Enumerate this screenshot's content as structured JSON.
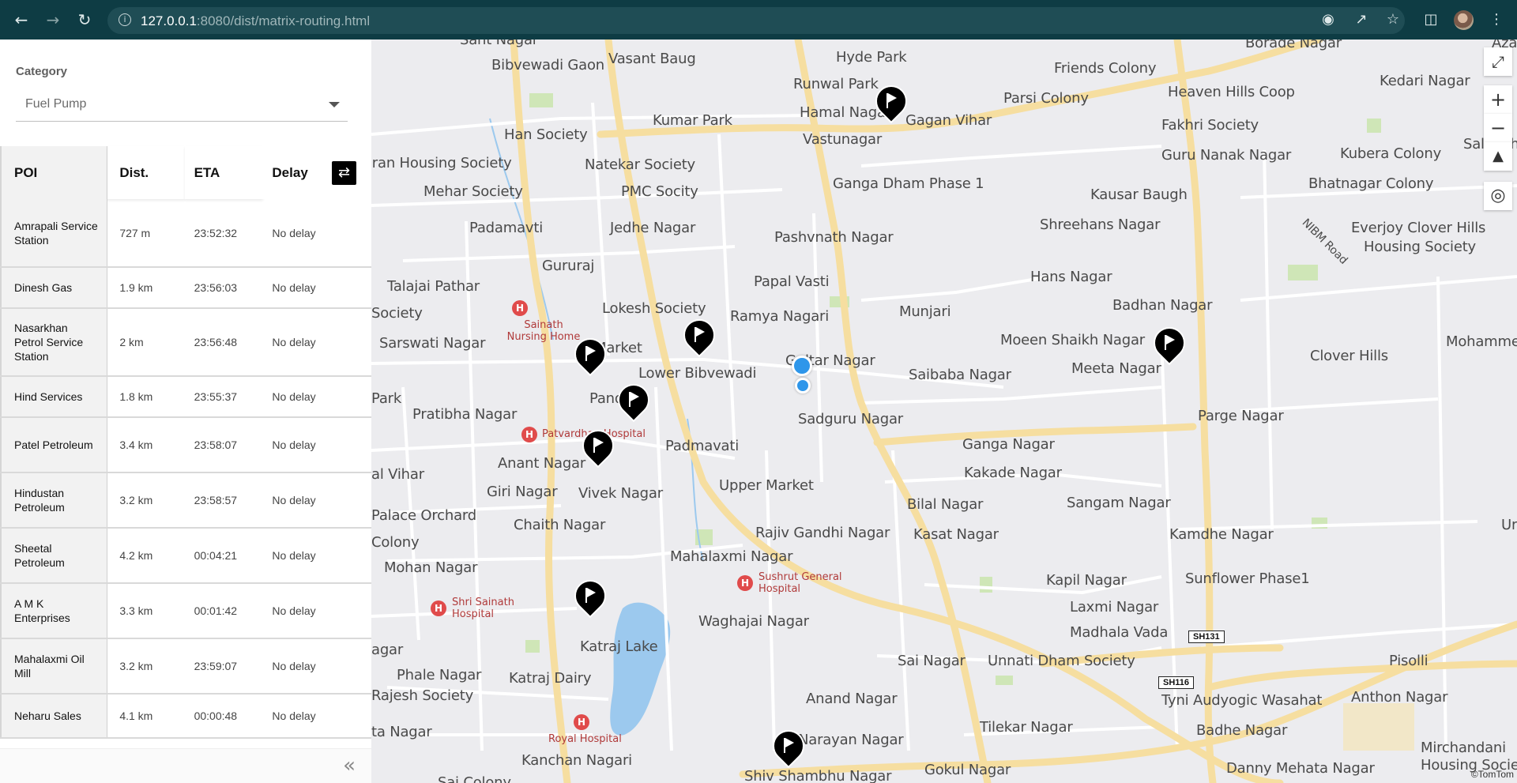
{
  "browser": {
    "url_host": "127.0.0.1",
    "url_rest": ":8080/dist/matrix-routing.html",
    "icons": [
      "back-icon",
      "forward-icon",
      "reload-icon",
      "info-icon",
      "location-icon",
      "share-icon",
      "star-icon",
      "sidepanel-icon",
      "profile-avatar",
      "menu-icon"
    ]
  },
  "sidebar": {
    "category_label": "Category",
    "category_value": "Fuel Pump",
    "columns": [
      "POI",
      "Dist.",
      "ETA",
      "Delay"
    ],
    "swap_icon": "swap-icon",
    "rows": [
      {
        "poi": "Amrapali Service Station",
        "dist": "727 m",
        "eta": "23:52:32",
        "delay": "No delay"
      },
      {
        "poi": "Dinesh Gas",
        "dist": "1.9 km",
        "eta": "23:56:03",
        "delay": "No delay"
      },
      {
        "poi": "Nasarkhan Petrol Service Station",
        "dist": "2 km",
        "eta": "23:56:48",
        "delay": "No delay"
      },
      {
        "poi": "Hind Services",
        "dist": "1.8 km",
        "eta": "23:55:37",
        "delay": "No delay"
      },
      {
        "poi": "Patel Petroleum",
        "dist": "3.4 km",
        "eta": "23:58:07",
        "delay": "No delay"
      },
      {
        "poi": "Hindustan Petroleum",
        "dist": "3.2 km",
        "eta": "23:58:57",
        "delay": "No delay"
      },
      {
        "poi": "Sheetal Petroleum",
        "dist": "4.2 km",
        "eta": "00:04:21",
        "delay": "No delay"
      },
      {
        "poi": "A M K Enterprises",
        "dist": "3.3 km",
        "eta": "00:01:42",
        "delay": "No delay"
      },
      {
        "poi": "Mahalaxmi Oil Mill",
        "dist": "3.2 km",
        "eta": "23:59:07",
        "delay": "No delay"
      },
      {
        "poi": "Neharu Sales",
        "dist": "4.1 km",
        "eta": "00:00:48",
        "delay": "No delay"
      }
    ],
    "collapse_icon": "double-chevron-left-icon"
  },
  "map": {
    "places": [
      "Sant Nagar",
      "Bibvewadi Gaon",
      "Vasant Baug",
      "Hyde Park",
      "Friends Colony",
      "Borade Nagar",
      "Azad Nag",
      "Kedari Nagar",
      "Runwal Park",
      "Hamal Nagar",
      "Gagan Vihar",
      "Parsi Colony",
      "Heaven Hills Coop",
      "Kumar Park",
      "Fakhri Society",
      "Han Society",
      "Vastunagar",
      "Guru Nanak Nagar",
      "Kubera Colony",
      "Salunkhe",
      "iran Housing Society",
      "Natekar Society",
      "Ganga Dham Phase 1",
      "Bhatnagar Colony",
      "Mehar Society",
      "PMC Socity",
      "Kausar Baugh",
      "Padamavti",
      "Jedhe Nagar",
      "Pashvnath Nagar",
      "Shreehans Nagar",
      "Everjoy Clover Hills",
      "Housing Society",
      "Gururaj",
      "Talajai Pathar",
      "Papal Vasti",
      "Hans Nagar",
      "Lokesh Society",
      "Ramya Nagari",
      "Munjari",
      "Badhan Nagar",
      "Society",
      "Sarswati Nagar",
      "Market",
      "Moeen Shaikh Nagar",
      "Mohammed W",
      "Lower Bibvewadi",
      "Gultar Nagar",
      "Saibaba Nagar",
      "Meeta Nagar",
      "Clover Hills",
      "Park",
      "Pandit",
      "Pratibha Nagar",
      "Sadguru Nagar",
      "Parge Nagar",
      "Padmavati",
      "Ganga Nagar",
      "Anant Nagar",
      "Kakade Nagar",
      "al Vihar",
      "Giri Nagar",
      "Vivek Nagar",
      "Upper Market",
      "Bilal Nagar",
      "Sangam Nagar",
      "Chaith Nagar",
      "Rajiv Gandhi Nagar",
      "Kasat Nagar",
      "Kamdhe Nagar",
      "Palace Orchard",
      "Colony",
      "Mahalaxmi Nagar",
      "Mohan Nagar",
      "Sunflower Phase1",
      "Kapil Nagar",
      "Laxmi Nagar",
      "Waghajai Nagar",
      "Katraj Lake",
      "Madhala Vada",
      "agar",
      "Sai Nagar",
      "Unnati Dham Society",
      "Pisolli",
      "Phale Nagar",
      "Katraj Dairy",
      "Rajesh Society",
      "Tyni Audyogic Wasahat",
      "Anand Nagar",
      "Anthon Nagar",
      "Tilekar Nagar",
      "Badhe Nagar",
      "Mirchandani",
      "Housing Society",
      "ta Nagar",
      "Kanchan Nagari",
      "Sai Colony",
      "Shiv Shambhu Nagar",
      "Gokul Nagar",
      "Danny Mehata Nagar",
      "Ur",
      "NIBM Road",
      "Narayan Nagar"
    ],
    "hospitals": [
      {
        "label": "Sainath Nursing Home"
      },
      {
        "label": "Patvardhan Hospital"
      },
      {
        "label": "Sushrut General Hospital"
      },
      {
        "label": "Shri Sainath Hospital"
      },
      {
        "label": "Royal Hospital"
      }
    ],
    "shields": [
      "SH131",
      "SH116"
    ],
    "controls": [
      "fullscreen-icon",
      "zoom-in-icon",
      "zoom-out-icon",
      "compass-icon",
      "geolocate-icon"
    ],
    "attribution": "©TomTom",
    "colors": {
      "pin": "#000000",
      "gps": "#2e96ea",
      "major_road": "#f6dea0",
      "minor_road": "#ffffff",
      "water": "#9cc9ee",
      "park": "#cfe6b7"
    }
  }
}
